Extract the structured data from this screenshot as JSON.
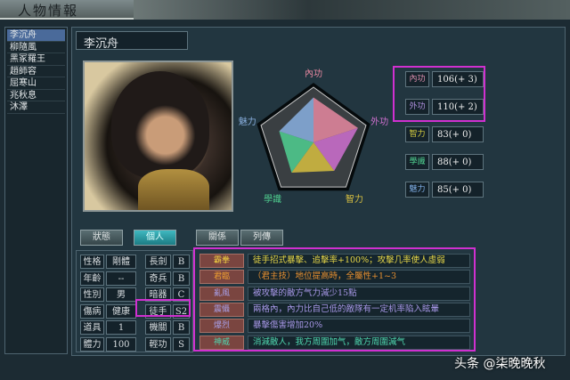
{
  "title": "人物情報",
  "characters": [
    "李沉舟",
    "柳隨風",
    "黑冢羅王",
    "趙師容",
    "屈寒山",
    "兆秋息",
    "沐澤"
  ],
  "selected_name": "李沉舟",
  "radar": {
    "axes": [
      "內功",
      "外功",
      "智力",
      "學識",
      "魅力"
    ],
    "values": [
      106,
      110,
      83,
      88,
      85
    ],
    "max": 130,
    "colors": [
      "#e888a0",
      "#d070d0",
      "#d8c040",
      "#50d090",
      "#8ab0e0"
    ]
  },
  "stats": [
    {
      "label": "內功",
      "value": "106(+ 3)",
      "color": "#e090b0"
    },
    {
      "label": "外功",
      "value": "110(+ 2)",
      "color": "#b090e0"
    },
    {
      "label": "智力",
      "value": "83(+ 0)",
      "color": "#d8d040"
    },
    {
      "label": "學識",
      "value": "88(+ 0)",
      "color": "#50d090"
    },
    {
      "label": "魅力",
      "value": "85(+ 0)",
      "color": "#80b0e8"
    }
  ],
  "tabs": [
    "狀態",
    "個人",
    "關係",
    "列傳"
  ],
  "active_tab": "個人",
  "personal": [
    [
      "性格",
      "剛體"
    ],
    [
      "年齡",
      "--"
    ],
    [
      "性別",
      "男"
    ],
    [
      "傷病",
      "健康"
    ],
    [
      "道具",
      "1"
    ],
    [
      "體力",
      "100"
    ]
  ],
  "weapons": [
    [
      "長劍",
      "B"
    ],
    [
      "奇兵",
      "B"
    ],
    [
      "暗器",
      "C"
    ],
    [
      "徒手",
      "S2"
    ],
    [
      "機關",
      "B"
    ],
    [
      "輕功",
      "S"
    ]
  ],
  "skills": [
    {
      "name": "霸拳",
      "desc": "徒手招式暴擊、追擊率+100%；攻擊几率使人虛弱",
      "color": "#e8d848",
      "ncolor": "#f0d040"
    },
    {
      "name": "君臨",
      "desc": "（君主技）地位提高時，全屬性+1~3",
      "color": "#e89030",
      "ncolor": "#f0a030"
    },
    {
      "name": "亂風",
      "desc": "被攻擊的敵方气力減少15點",
      "color": "#a898e8",
      "ncolor": "#a8a0e8"
    },
    {
      "name": "震懾",
      "desc": "兩格內，內力比自己低的敵隊有一定机率陷入眩暈",
      "color": "#a898e8",
      "ncolor": "#a8a0e8"
    },
    {
      "name": "爆烈",
      "desc": "暴擊傷害增加20%",
      "color": "#a898e8",
      "ncolor": "#a8a0e8"
    },
    {
      "name": "神威",
      "desc": "消減敵人，我方周圍加气，敵方周圍減气",
      "color": "#50d8b0",
      "ncolor": "#50d8b0"
    }
  ],
  "watermark": "头条 @柒晚晚秋"
}
